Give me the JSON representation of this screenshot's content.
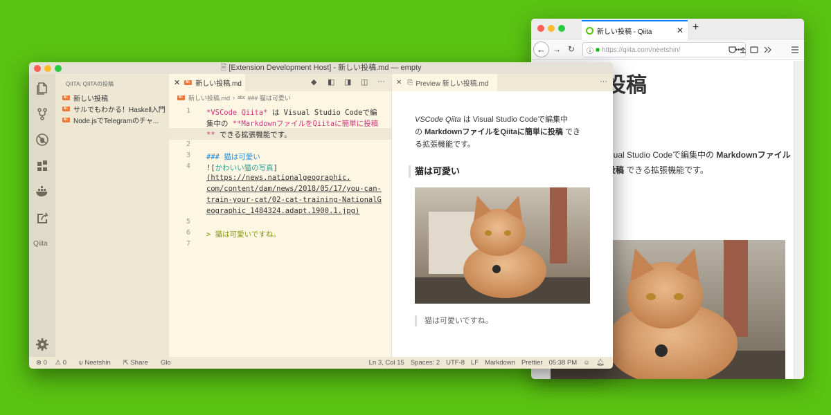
{
  "colors": {
    "accent": "#0a84ff",
    "qiita_green": "#55c500",
    "markdown_icon": "#e9793b",
    "background": "#59c312"
  },
  "browser": {
    "tab_title": "新しい投稿 - Qiita",
    "url": "https://qiita.com/neetshin/",
    "heading": "投稿",
    "para_line1": "isual Studio Codeで編集中の ",
    "para_bold1": "Markdownファイル",
    "para_bold2": "投稿",
    "para_line2": " できる拡張機能です。"
  },
  "vscode": {
    "window_title": "[Extension Development Host] - 新しい投稿.md — empty",
    "activity_label": "Qiita",
    "sidebar": {
      "header": "QIITA: QIITAの投稿",
      "items": [
        {
          "label": "新しい投稿"
        },
        {
          "label": "サルでもわかる！Haskell入門"
        },
        {
          "label": "Node.jsでTelegramのチャ..."
        }
      ]
    },
    "editor_tab": "新しい投稿.md",
    "breadcrumb_file": "新しい投稿.md",
    "breadcrumb_symbol": "### 猫は可愛い",
    "lines": [
      "1",
      "2",
      "3",
      "4",
      "5",
      "6",
      "7"
    ],
    "code": {
      "l1a": "*VSCode Qiita*",
      "l1b": " は Visual Studio Codeで編",
      "l1c": "集中の ",
      "l1d": "**Markdownファイルを",
      "l1e": "Qiitaに簡単に投稿",
      "l1f": "**",
      "l1g": " できる拡張機能です。",
      "l3": "### 猫は可愛い",
      "l4a": "![",
      "l4b": "かわいい猫の写真",
      "l4c": "]",
      "l4d": "(https://news.nationalgeographic.",
      "l4e": "com/content/dam/news/2018/05/17/you-can-",
      "l4f": "train-your-cat/02-cat-training-NationalG",
      "l4g": "eographic_1484324.adapt.1900.1.jpg)",
      "l6": "> 猫は可愛いですね。"
    },
    "preview": {
      "tab": "Preview 新しい投稿.md",
      "p_italic": "VSCode Qiita",
      "p_text1": " は Visual Studio Codeで編集中",
      "p_text2": "の ",
      "p_bold": "MarkdownファイルをQiitaに簡単に投稿",
      "p_text3": " でき",
      "p_text4": "る拡張機能です。",
      "heading": "猫は可愛い",
      "blockquote": "猫は可愛いですね。"
    },
    "status": {
      "errors": "0",
      "warnings": "0",
      "user": "Neetshin",
      "share": "Share",
      "glo": "Glo",
      "position": "Ln 3, Col 15",
      "spaces": "Spaces: 2",
      "encoding": "UTF-8",
      "eol": "LF",
      "language": "Markdown",
      "formatter": "Prettier",
      "time": "05:38 PM"
    }
  }
}
